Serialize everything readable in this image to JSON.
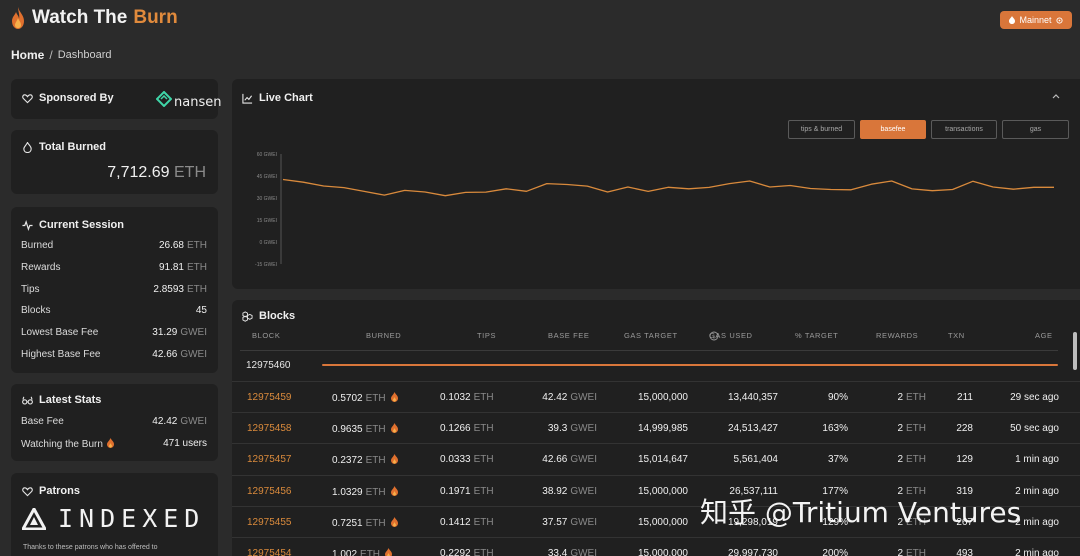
{
  "app": {
    "title_part1": "Watch The ",
    "title_part2": "Burn",
    "network_button": "Mainnet"
  },
  "breadcrumb": {
    "home": "Home",
    "separator": "/",
    "current": "Dashboard"
  },
  "sponsor": {
    "title": "Sponsored By",
    "logo_text": "nansen"
  },
  "total_burned": {
    "title": "Total Burned",
    "value": "7,712.69",
    "unit": "ETH"
  },
  "current_session": {
    "title": "Current Session",
    "rows": [
      {
        "label": "Burned",
        "value": "26.68",
        "unit": "ETH"
      },
      {
        "label": "Rewards",
        "value": "91.81",
        "unit": "ETH"
      },
      {
        "label": "Tips",
        "value": "2.8593",
        "unit": "ETH"
      },
      {
        "label": "Blocks",
        "value": "45",
        "unit": ""
      },
      {
        "label": "Lowest Base Fee",
        "value": "31.29",
        "unit": "GWEI"
      },
      {
        "label": "Highest Base Fee",
        "value": "42.66",
        "unit": "GWEI"
      }
    ]
  },
  "latest_stats": {
    "title": "Latest Stats",
    "rows": [
      {
        "label": "Base Fee",
        "value": "42.42",
        "unit": "GWEI"
      },
      {
        "label": "Watching the Burn",
        "value": "471 users",
        "unit": ""
      }
    ]
  },
  "patrons": {
    "title": "Patrons",
    "logo_text": "INDEXED",
    "note": "Thanks to these patrons who has offered to"
  },
  "live_chart": {
    "title": "Live Chart",
    "buttons": [
      {
        "label": "tips & burned",
        "active": false
      },
      {
        "label": "basefee",
        "active": true
      },
      {
        "label": "transactions",
        "active": false
      },
      {
        "label": "gas",
        "active": false
      }
    ],
    "y_ticks": [
      "60 GWEI",
      "45 GWEI",
      "30 GWEI",
      "15 GWEI",
      "0 GWEI",
      "-15 GWEI"
    ]
  },
  "chart_data": {
    "type": "line",
    "title": "Live Chart",
    "series": [
      {
        "name": "basefee",
        "color": "#d98a3c",
        "values": [
          42.6,
          40.8,
          38.2,
          37.1,
          34.5,
          32.0,
          35.2,
          34.1,
          31.6,
          33.8,
          34.0,
          36.3,
          34.6,
          39.8,
          39.2,
          38.1,
          34.1,
          37.5,
          34.5,
          37.3,
          36.3,
          37.2,
          39.8,
          41.6,
          37.5,
          38.5,
          36.5,
          35.8,
          35.6,
          39.4,
          41.6,
          36.2,
          35.0,
          35.8,
          41.4,
          37.5,
          36.0,
          37.3,
          37.3
        ]
      }
    ],
    "ylim": [
      -15,
      60
    ],
    "grid": false,
    "legend": "none"
  },
  "blocks": {
    "title": "Blocks",
    "columns": [
      "BLOCK",
      "BURNED",
      "TIPS",
      "BASE FEE",
      "GAS TARGET",
      "GAS USED",
      "% TARGET",
      "REWARDS",
      "TXN",
      "AGE"
    ],
    "pending_block": "12975460",
    "rows": [
      {
        "block": "12975459",
        "burned": "0.5702",
        "tips": "0.1032",
        "base_fee": "42.42",
        "gas_target": "15,000,000",
        "gas_used": "13,440,357",
        "pct_target": "90%",
        "rewards": "2",
        "txn": "211",
        "age": "29 sec ago"
      },
      {
        "block": "12975458",
        "burned": "0.9635",
        "tips": "0.1266",
        "base_fee": "39.3",
        "gas_target": "14,999,985",
        "gas_used": "24,513,427",
        "pct_target": "163%",
        "rewards": "2",
        "txn": "228",
        "age": "50 sec ago"
      },
      {
        "block": "12975457",
        "burned": "0.2372",
        "tips": "0.0333",
        "base_fee": "42.66",
        "gas_target": "15,014,647",
        "gas_used": "5,561,404",
        "pct_target": "37%",
        "rewards": "2",
        "txn": "129",
        "age": "1 min ago"
      },
      {
        "block": "12975456",
        "burned": "1.0329",
        "tips": "0.1971",
        "base_fee": "38.92",
        "gas_target": "15,000,000",
        "gas_used": "26,537,111",
        "pct_target": "177%",
        "rewards": "2",
        "txn": "319",
        "age": "2 min ago"
      },
      {
        "block": "12975455",
        "burned": "0.7251",
        "tips": "0.1412",
        "base_fee": "37.57",
        "gas_target": "15,000,000",
        "gas_used": "19,298,019",
        "pct_target": "129%",
        "rewards": "2",
        "txn": "267",
        "age": "2 min ago"
      },
      {
        "block": "12975454",
        "burned": "1.002",
        "tips": "0.2292",
        "base_fee": "33.4",
        "gas_target": "15,000,000",
        "gas_used": "29,997,730",
        "pct_target": "200%",
        "rewards": "2",
        "txn": "493",
        "age": "2 min ago"
      }
    ],
    "units": {
      "eth": "ETH",
      "gwei": "GWEI"
    }
  },
  "watermark": "知乎 @Tritium Ventures",
  "colors": {
    "accent": "#d9763a",
    "block_link": "#d98a3c",
    "card": "#202020",
    "page": "#2b2b2b"
  }
}
